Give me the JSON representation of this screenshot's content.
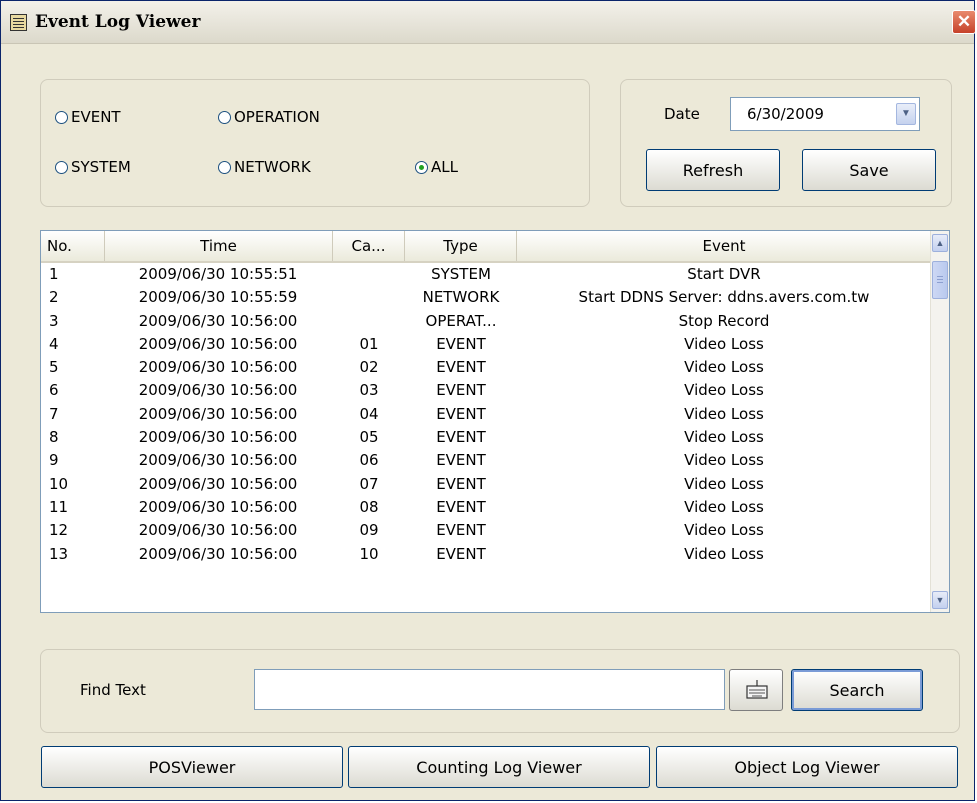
{
  "window": {
    "title": "Event Log Viewer",
    "close": "✕"
  },
  "filters": {
    "options": [
      {
        "label": "EVENT",
        "checked": false
      },
      {
        "label": "OPERATION",
        "checked": false
      },
      {
        "label": "SYSTEM",
        "checked": false
      },
      {
        "label": "NETWORK",
        "checked": false
      },
      {
        "label": "ALL",
        "checked": true
      }
    ]
  },
  "date_panel": {
    "date_label": "Date",
    "date_value": "6/30/2009",
    "refresh_label": "Refresh",
    "save_label": "Save"
  },
  "log_table": {
    "columns": [
      "No.",
      "Time",
      "Ca...",
      "Type",
      "Event"
    ],
    "rows": [
      {
        "no": "1",
        "time": "2009/06/30 10:55:51",
        "ca": "",
        "type": "SYSTEM",
        "event": "Start DVR"
      },
      {
        "no": "2",
        "time": "2009/06/30 10:55:59",
        "ca": "",
        "type": "NETWORK",
        "event": "Start DDNS Server: ddns.avers.com.tw"
      },
      {
        "no": "3",
        "time": "2009/06/30 10:56:00",
        "ca": "",
        "type": "OPERAT...",
        "event": "Stop Record"
      },
      {
        "no": "4",
        "time": "2009/06/30 10:56:00",
        "ca": "01",
        "type": "EVENT",
        "event": "Video Loss"
      },
      {
        "no": "5",
        "time": "2009/06/30 10:56:00",
        "ca": "02",
        "type": "EVENT",
        "event": "Video Loss"
      },
      {
        "no": "6",
        "time": "2009/06/30 10:56:00",
        "ca": "03",
        "type": "EVENT",
        "event": "Video Loss"
      },
      {
        "no": "7",
        "time": "2009/06/30 10:56:00",
        "ca": "04",
        "type": "EVENT",
        "event": "Video Loss"
      },
      {
        "no": "8",
        "time": "2009/06/30 10:56:00",
        "ca": "05",
        "type": "EVENT",
        "event": "Video Loss"
      },
      {
        "no": "9",
        "time": "2009/06/30 10:56:00",
        "ca": "06",
        "type": "EVENT",
        "event": "Video Loss"
      },
      {
        "no": "10",
        "time": "2009/06/30 10:56:00",
        "ca": "07",
        "type": "EVENT",
        "event": "Video Loss"
      },
      {
        "no": "11",
        "time": "2009/06/30 10:56:00",
        "ca": "08",
        "type": "EVENT",
        "event": "Video Loss"
      },
      {
        "no": "12",
        "time": "2009/06/30 10:56:00",
        "ca": "09",
        "type": "EVENT",
        "event": "Video Loss"
      },
      {
        "no": "13",
        "time": "2009/06/30 10:56:00",
        "ca": "10",
        "type": "EVENT",
        "event": "Video Loss"
      }
    ]
  },
  "find": {
    "label": "Find Text",
    "value": "",
    "keyboard_icon": "keyboard-icon",
    "search_label": "Search"
  },
  "footer": {
    "pos_viewer": "POSViewer",
    "counting_log_viewer": "Counting Log Viewer",
    "object_log_viewer": "Object Log Viewer"
  },
  "colors": {
    "accent": "#003c74",
    "window_bg": "#ece9d8",
    "radio_checked": "#21a121"
  }
}
